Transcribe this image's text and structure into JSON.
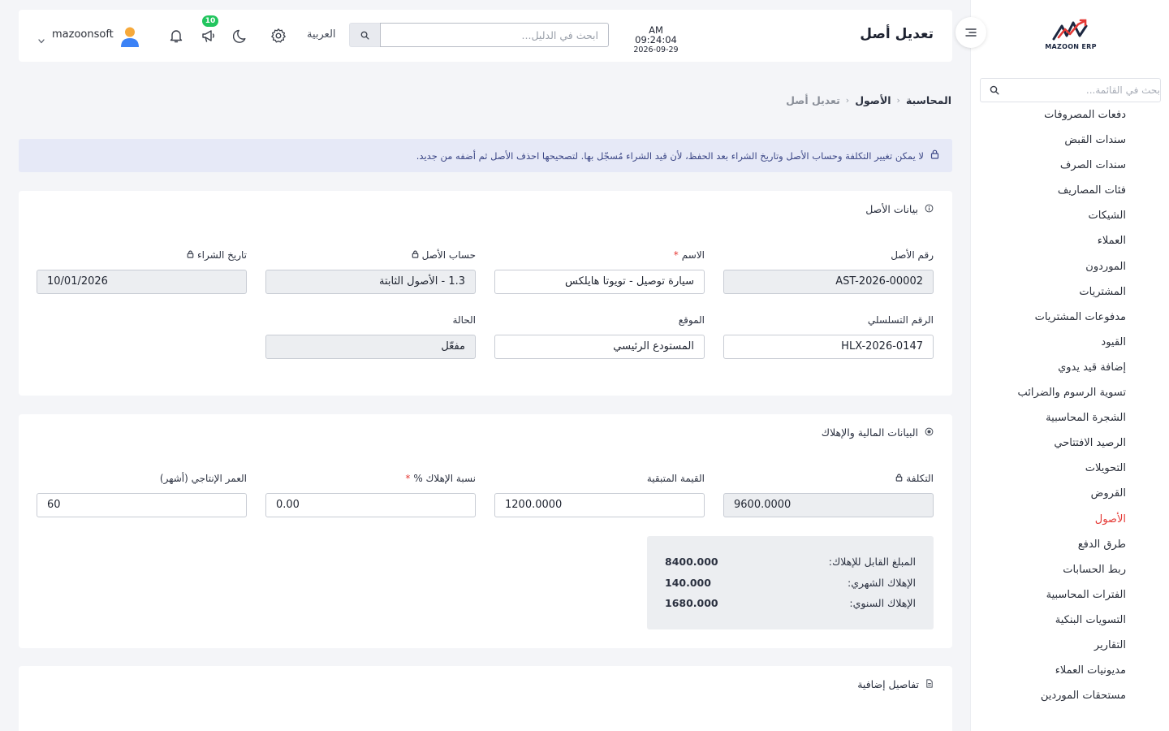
{
  "header": {
    "title": "تعديل أصل",
    "time": "AM 09:24:04",
    "date": "2026-09-29",
    "search_placeholder": "ابحث في الدليل...",
    "language": "العربية",
    "notification_count": "10",
    "username": "mazoonsoft"
  },
  "sidebar": {
    "logo_text": "MAZOON ERP",
    "search_placeholder": "بحث في القائمة...",
    "items": [
      {
        "label": "دفعات المصروفات"
      },
      {
        "label": "سندات القبض"
      },
      {
        "label": "سندات الصرف"
      },
      {
        "label": "فئات المصاريف"
      },
      {
        "label": "الشيكات"
      },
      {
        "label": "العملاء"
      },
      {
        "label": "الموردون"
      },
      {
        "label": "المشتريات"
      },
      {
        "label": "مدفوعات المشتريات"
      },
      {
        "label": "القيود"
      },
      {
        "label": "إضافة قيد يدوي"
      },
      {
        "label": "تسوية الرسوم والضرائب"
      },
      {
        "label": "الشجرة المحاسبية"
      },
      {
        "label": "الرصيد الافتتاحي"
      },
      {
        "label": "التحويلات"
      },
      {
        "label": "القروض"
      },
      {
        "label": "الأصول",
        "active": true
      },
      {
        "label": "طرق الدفع"
      },
      {
        "label": "ربط الحسابات"
      },
      {
        "label": "الفترات المحاسبية"
      },
      {
        "label": "التسويات البنكية"
      },
      {
        "label": "التقارير"
      },
      {
        "label": "مديونيات العملاء"
      },
      {
        "label": "مستحقات الموردين"
      }
    ]
  },
  "breadcrumb": {
    "items": [
      "المحاسبة",
      "الأصول"
    ],
    "current": "تعديل أصل"
  },
  "alert": {
    "text": "لا يمكن تغيير التكلفة وحساب الأصل وتاريخ الشراء بعد الحفظ، لأن قيد الشراء مُسجّل بها. لتصحيحها احذف الأصل ثم أضفه من جديد."
  },
  "asset_card": {
    "title": "بيانات الأصل",
    "asset_number": {
      "label": "رقم الأصل",
      "value": "AST-2026-00002"
    },
    "name": {
      "label": "الاسم",
      "required": "*",
      "value": "سيارة توصيل - تويوتا هايلكس"
    },
    "asset_account": {
      "label": "حساب الأصل",
      "value": "1.3 - الأصول الثابتة"
    },
    "purchase_date": {
      "label": "تاريخ الشراء",
      "value": "10/01/2026"
    },
    "serial_number": {
      "label": "الرقم التسلسلي",
      "value": "HLX-2026-0147"
    },
    "location": {
      "label": "الموقع",
      "value": "المستودع الرئيسي"
    },
    "status": {
      "label": "الحالة",
      "value": "مفعّل"
    }
  },
  "financial_card": {
    "title": "البيانات المالية والإهلاك",
    "cost": {
      "label": "التكلفة",
      "value": "9600.0000"
    },
    "residual_value": {
      "label": "القيمة المتبقية",
      "value": "1200.0000"
    },
    "depreciation_rate": {
      "label": "نسبة الإهلاك %",
      "required": "*",
      "value": "0.00"
    },
    "useful_life": {
      "label": "العمر الإنتاجي (أشهر)",
      "value": "60"
    },
    "summary": {
      "depreciable_label": "المبلغ القابل للإهلاك:",
      "depreciable_value": "8400.000",
      "monthly_label": "الإهلاك الشهري:",
      "monthly_value": "140.000",
      "annual_label": "الإهلاك السنوي:",
      "annual_value": "1680.000"
    }
  },
  "extra_card": {
    "title": "تفاصيل إضافية"
  },
  "colors": {
    "accent": "#e53935",
    "badge": "#22c55e",
    "alert_bg": "#e6e9f7",
    "alert_text": "#3c4786"
  }
}
